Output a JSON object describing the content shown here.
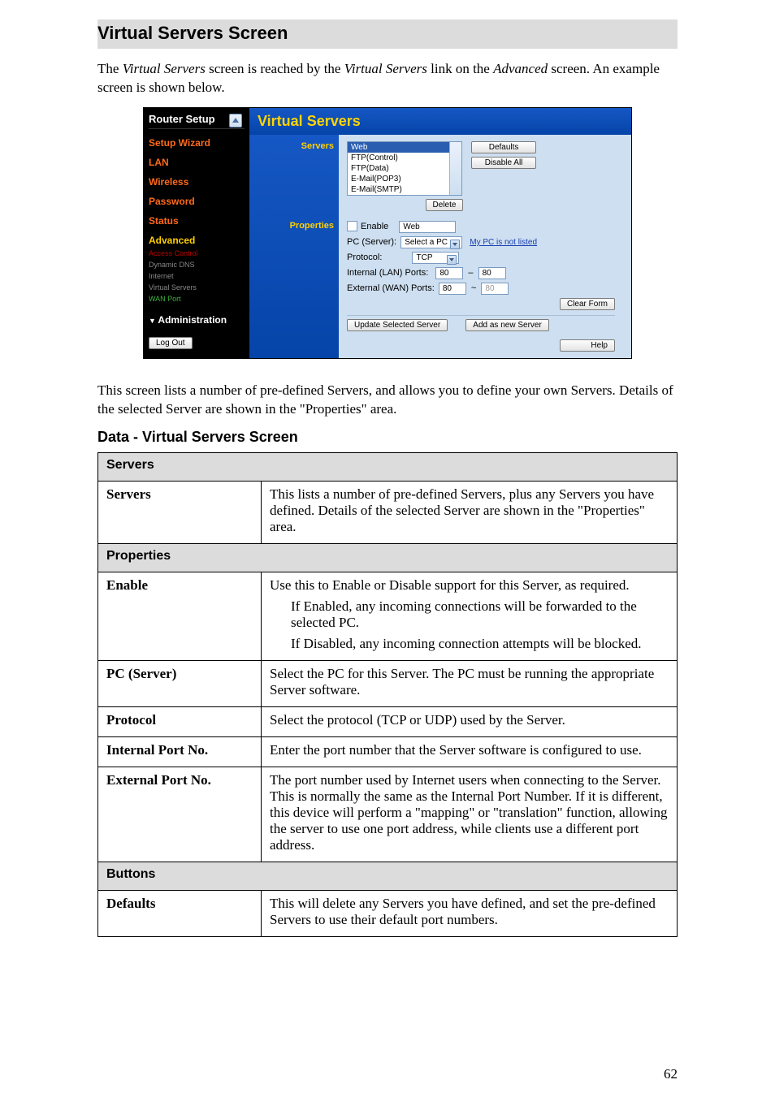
{
  "heading": "Virtual Servers Screen",
  "intro": {
    "pre": "The ",
    "em1": "Virtual Servers",
    "mid1": " screen is reached by the ",
    "em2": "Virtual Servers",
    "mid2": " link on the ",
    "em3": "Advanced",
    "post": " screen. An example screen is shown below."
  },
  "shot": {
    "router_title": "Router Setup",
    "nav": {
      "setup_wizard": "Setup Wizard",
      "lan": "LAN",
      "wireless": "Wireless",
      "password": "Password",
      "status": "Status",
      "advanced": "Advanced",
      "access_control": "Access Control",
      "dynamic_dns": "Dynamic DNS",
      "internet": "Internet",
      "virtual_servers": "Virtual Servers",
      "wan_port": "WAN Port",
      "administration": "Administration",
      "logout": "Log Out"
    },
    "title": "Virtual Servers",
    "labels": {
      "servers": "Servers",
      "properties": "Properties"
    },
    "servers_list": {
      "selected": "Web",
      "opts": [
        "FTP(Control)",
        "FTP(Data)",
        "E-Mail(POP3)",
        "E-Mail(SMTP)"
      ]
    },
    "buttons": {
      "defaults": "Defaults",
      "disable_all": "Disable All",
      "delete": "Delete",
      "clear_form": "Clear Form",
      "update": "Update Selected Server",
      "add": "Add as new Server",
      "help": "Help"
    },
    "props": {
      "enable": "Enable",
      "enable_val": "Web",
      "pc_server": "PC (Server):",
      "pc_server_val": "Select a PC",
      "pc_link": "My PC is not listed",
      "protocol": "Protocol:",
      "protocol_val": "TCP",
      "int_ports": "Internal (LAN) Ports:",
      "int_a": "80",
      "int_b": "80",
      "ext_ports": "External (WAN) Ports:",
      "ext_a": "80",
      "ext_b": "80"
    }
  },
  "after_shot": "This screen lists a number of pre-defined Servers, and allows you to define your own Servers. Details of the selected Server are shown in the \"Properties\" area.",
  "table_heading": "Data - Virtual Servers Screen",
  "table": {
    "cat1": "Servers",
    "r1k": "Servers",
    "r1v": "This lists a number of pre-defined Servers, plus any Servers you have defined. Details of the selected Server are shown in the \"Properties\" area.",
    "cat2": "Properties",
    "r2k": "Enable",
    "r2v_main": "Use this to Enable or Disable support for this Server, as required.",
    "r2v_sub1": "If Enabled, any incoming connections will be forwarded to the selected PC.",
    "r2v_sub2": "If Disabled, any incoming connection attempts will be blocked.",
    "r3k": "PC (Server)",
    "r3v": "Select the PC for this Server. The PC must be running the appropriate Server software.",
    "r4k": "Protocol",
    "r4v": "Select the protocol (TCP or UDP) used by the Server.",
    "r5k": "Internal Port No.",
    "r5v": "Enter the port number that the Server software is configured to use.",
    "r6k": "External Port No.",
    "r6v": "The port number used by Internet users when connecting to the Server. This is normally the same as the Internal Port Number. If it is different, this device will perform a \"mapping\" or \"translation\" function, allowing the server to use one port address, while clients use a different port address.",
    "cat3": "Buttons",
    "r7k": "Defaults",
    "r7v": "This will delete any Servers you have defined, and set the pre-defined Servers to use their default port numbers."
  },
  "page_number": "62"
}
